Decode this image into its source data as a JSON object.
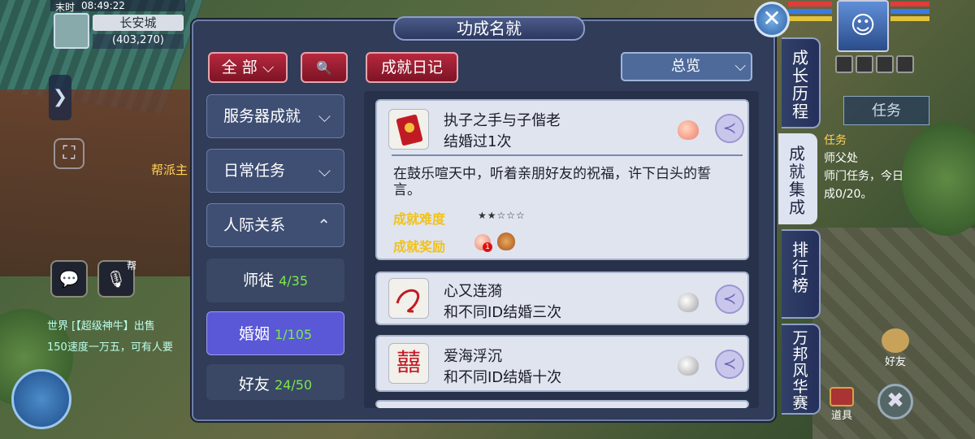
{
  "hud": {
    "clock_label": "末时",
    "clock_time": "08:49:22",
    "city": "长安城",
    "coords": "(403,270)",
    "guild_label": "帮派主",
    "side_arrow": "❯",
    "expand_glyph": "⛶",
    "chat_icon": "💬",
    "mic_icon": "🎙",
    "mic_tag": "帮",
    "chat_line1": "世界 [【超级神牛】出售",
    "chat_line2": "150速度一万五，可有人要",
    "task_tab": "任务",
    "task_text_1": "任务",
    "task_text_2": "师父",
    "task_text_3": "处",
    "task_text_4": "师门任务，今日",
    "task_text_5": "成0/20。",
    "friend_label": "好友",
    "bag_label": "道具",
    "avatar_glyph": "☺",
    "close_glyph": "✖",
    "colors": {
      "hp": "#e23b3b",
      "mp": "#3b7ae2",
      "sp": "#e2c23b"
    }
  },
  "panel": {
    "title": "功成名就",
    "close_glyph": "✕",
    "top_buttons": {
      "all": "全 部",
      "all_chevron": "⌵",
      "search_icon": "🔍",
      "diary": "成就日记"
    },
    "overview": {
      "label": "总览",
      "chevron": "⌵"
    },
    "categories": [
      {
        "label": "服务器成就",
        "chevron": "⌵"
      },
      {
        "label": "日常任务",
        "chevron": "⌵"
      },
      {
        "label": "人际关系",
        "chevron": "⌃"
      }
    ],
    "subcategories": [
      {
        "label": "师徒",
        "count": "4/35"
      },
      {
        "label": "婚姻",
        "count": "1/105"
      },
      {
        "label": "好友",
        "count": "24/50"
      }
    ],
    "cards": [
      {
        "title": "执子之手与子偕老",
        "subtitle": "结婚过1次",
        "description": "在鼓乐喧天中，听着亲朋好友的祝福，许下白头的誓言。",
        "difficulty_label": "成就难度",
        "stars": "★★☆☆☆",
        "reward_label": "成就奖励",
        "reward_count": "1"
      },
      {
        "title": "心又连漪",
        "subtitle": "和不同ID结婚三次"
      },
      {
        "title": "爱海浮沉",
        "subtitle": "和不同ID结婚十次"
      }
    ],
    "share_glyph": "≺",
    "xi_glyph": "囍"
  },
  "side_tabs": [
    {
      "label": "成长历程"
    },
    {
      "label": "成就集成"
    },
    {
      "label": "排行榜"
    },
    {
      "label": "万邦风华赛"
    }
  ]
}
